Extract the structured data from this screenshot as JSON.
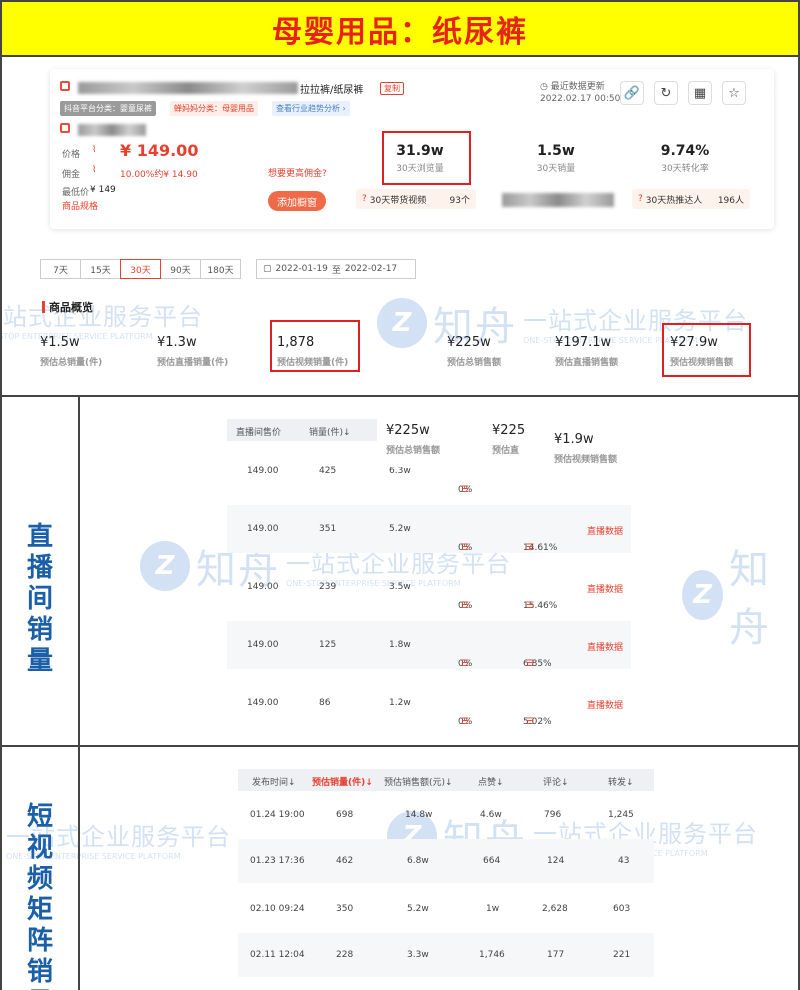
{
  "banner": {
    "title": "母婴用品：纸尿裤"
  },
  "product": {
    "name_suffix": "拉拉裤/纸尿裤",
    "copy_label": "复制",
    "category_tag": "抖音平台分类：婴童尿裤",
    "mom_category_tag": "蝉妈妈分类：母婴用品",
    "trend_link": "查看行业趋势分析 ›",
    "price_label": "价格",
    "price_value": "¥ 149.00",
    "commission_label": "佣金",
    "commission_value": "10.00%约¥ 14.90",
    "min_price_label": "最低价",
    "min_price_value": "¥ 149",
    "spec_link": "商品规格",
    "higher_commission_link": "想要更高佣金?",
    "add_button": "添加橱窗",
    "update_label": "最近数据更新",
    "update_time": "2022.02.17 00:50",
    "icons": [
      "link-icon",
      "refresh-icon",
      "qrcode-icon",
      "star-icon"
    ]
  },
  "stats": [
    {
      "value": "31.9w",
      "label": "30天浏览量"
    },
    {
      "value": "1.5w",
      "label": "30天销量"
    },
    {
      "value": "9.74%",
      "label": "30天转化率"
    }
  ],
  "pills": [
    {
      "label": "30天带货视频",
      "value": "93个"
    },
    {
      "label": "30天热推达人",
      "value": "196人"
    }
  ],
  "date_tabs": [
    "7天",
    "15天",
    "30天",
    "90天",
    "180天"
  ],
  "active_tab": "30天",
  "date_range": {
    "start": "2022-01-19",
    "sep": "至",
    "end": "2022-02-17"
  },
  "overview": {
    "title": "商品概览",
    "items": [
      {
        "value": "¥1.5w",
        "label": "预估总销量(件)"
      },
      {
        "value": "¥1.3w",
        "label": "预估直播销量(件)"
      },
      {
        "value": "1,878",
        "label": "预估视频销量(件)"
      },
      {
        "value": "¥225w",
        "label": "预估总销售额"
      },
      {
        "value": "¥197.1w",
        "label": "预估直播销售额"
      },
      {
        "value": "¥27.9w",
        "label": "预估视频销售额"
      }
    ]
  },
  "live_section": {
    "side_label": "直播间销量",
    "headers": [
      "直播间售价",
      "销量(件)↓"
    ],
    "overlay": {
      "v1": "¥225w",
      "l1": "预估总销售额",
      "v2": "¥225",
      "l2": "预估直",
      "v3": "¥1.9w",
      "l3": "预估视频销售额"
    },
    "rows": [
      {
        "price": "149.00",
        "sales": "425",
        "amount": "6.3w",
        "pct": "0%",
        "ratio": "",
        "link": ""
      },
      {
        "price": "149.00",
        "sales": "351",
        "amount": "5.2w",
        "pct": "0%",
        "ratio": "14.61%",
        "link": "直播数据"
      },
      {
        "price": "149.00",
        "sales": "239",
        "amount": "3.5w",
        "pct": "0%",
        "ratio": "15.46%",
        "link": "直播数据"
      },
      {
        "price": "149.00",
        "sales": "125",
        "amount": "1.8w",
        "pct": "0%",
        "ratio": "6.85%",
        "link": "直播数据"
      },
      {
        "price": "149.00",
        "sales": "86",
        "amount": "1.2w",
        "pct": "0%",
        "ratio": "5.02%",
        "link": "直播数据"
      }
    ]
  },
  "video_section": {
    "side_label": "短视频矩阵销量",
    "headers": [
      "发布时间↓",
      "预估销量(件)↓",
      "预估销售额(元)↓",
      "点赞↓",
      "评论↓",
      "转发↓"
    ],
    "rows": [
      {
        "time": "01.24 19:00",
        "sales": "698",
        "amount": "14.8w",
        "likes": "4.6w",
        "comments": "796",
        "shares": "1,245"
      },
      {
        "time": "01.23 17:36",
        "sales": "462",
        "amount": "6.8w",
        "likes": "664",
        "comments": "124",
        "shares": "43"
      },
      {
        "time": "02.10 09:24",
        "sales": "350",
        "amount": "5.2w",
        "likes": "1w",
        "comments": "2,628",
        "shares": "603"
      },
      {
        "time": "02.11 12:04",
        "sales": "228",
        "amount": "3.3w",
        "likes": "1,746",
        "comments": "177",
        "shares": "221"
      }
    ]
  },
  "watermark": {
    "brand": "知舟",
    "slogan": "一站式企业服务平台",
    "sub": "ONE-STOP ENTERPRISE SERVICE PLATFORM"
  }
}
